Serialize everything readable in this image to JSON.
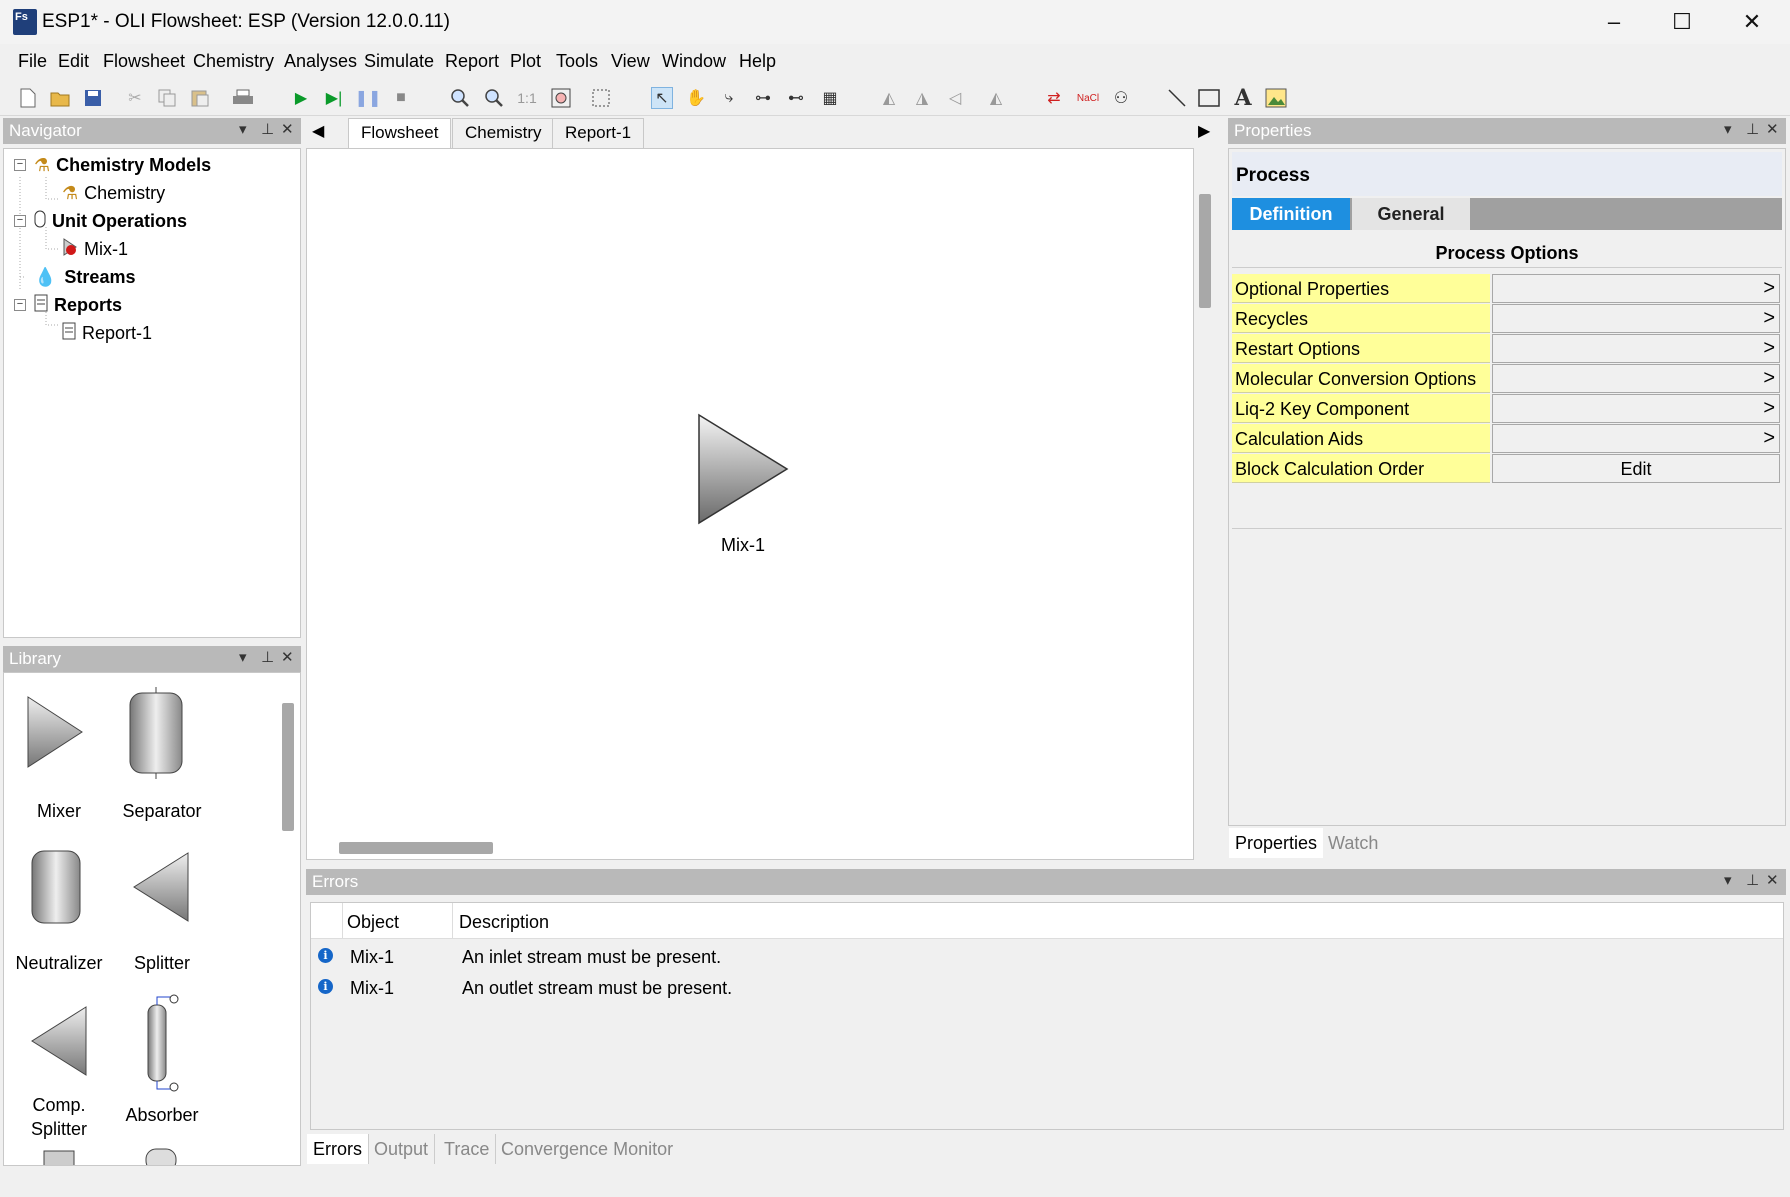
{
  "window": {
    "title": "ESP1* - OLI Flowsheet: ESP (Version 12.0.0.11)",
    "app_icon": "Fs",
    "minimize": "–",
    "maximize": "☐",
    "close": "✕"
  },
  "menu": [
    "File",
    "Edit",
    "Flowsheet",
    "Chemistry",
    "Analyses",
    "Simulate",
    "Report",
    "Plot",
    "Tools",
    "View",
    "Window",
    "Help"
  ],
  "navigator": {
    "title": "Navigator",
    "items": [
      {
        "label": "Chemistry Models",
        "bold": true,
        "icon": "flask-icon"
      },
      {
        "label": "Chemistry",
        "bold": false,
        "icon": "flask-icon"
      },
      {
        "label": "Unit Operations",
        "bold": true,
        "icon": "vessel-icon"
      },
      {
        "label": "Mix-1",
        "bold": false,
        "icon": "mixer-error-icon"
      },
      {
        "label": "Streams",
        "bold": true,
        "icon": "drop-icon"
      },
      {
        "label": "Reports",
        "bold": true,
        "icon": "report-icon"
      },
      {
        "label": "Report-1",
        "bold": false,
        "icon": "report-icon"
      }
    ]
  },
  "library": {
    "title": "Library",
    "items": [
      "Mixer",
      "Separator",
      "Neutralizer",
      "Splitter",
      "Comp.\nSplitter",
      "Absorber"
    ]
  },
  "tabs": [
    "Flowsheet",
    "Chemistry",
    "Report-1"
  ],
  "canvas": {
    "block_label": "Mix-1"
  },
  "properties": {
    "panel_title": "Properties",
    "object_title": "Process",
    "tabs": [
      "Definition",
      "General"
    ],
    "section": "Process Options",
    "rows": [
      {
        "label": "Optional Properties",
        "value": ""
      },
      {
        "label": "Recycles",
        "value": ""
      },
      {
        "label": "Restart Options",
        "value": ""
      },
      {
        "label": "Molecular Conversion Options",
        "value": ""
      },
      {
        "label": "Liq-2 Key Component",
        "value": ""
      },
      {
        "label": "Calculation Aids",
        "value": ""
      },
      {
        "label": "Block Calculation Order",
        "value": "Edit"
      }
    ],
    "bottom_tabs": [
      "Properties",
      "Watch"
    ]
  },
  "errors": {
    "title": "Errors",
    "columns": [
      "Object",
      "Description"
    ],
    "rows": [
      {
        "object": "Mix-1",
        "description": "An inlet stream must be present."
      },
      {
        "object": "Mix-1",
        "description": "An outlet stream must be present."
      }
    ],
    "bottom_tabs": [
      "Errors",
      "Output",
      "Trace",
      "Convergence Monitor"
    ]
  },
  "colors": {
    "panel_header": "#b9b9b9",
    "accent_tab": "#1e8fe0",
    "property_label": "#ffff99"
  }
}
